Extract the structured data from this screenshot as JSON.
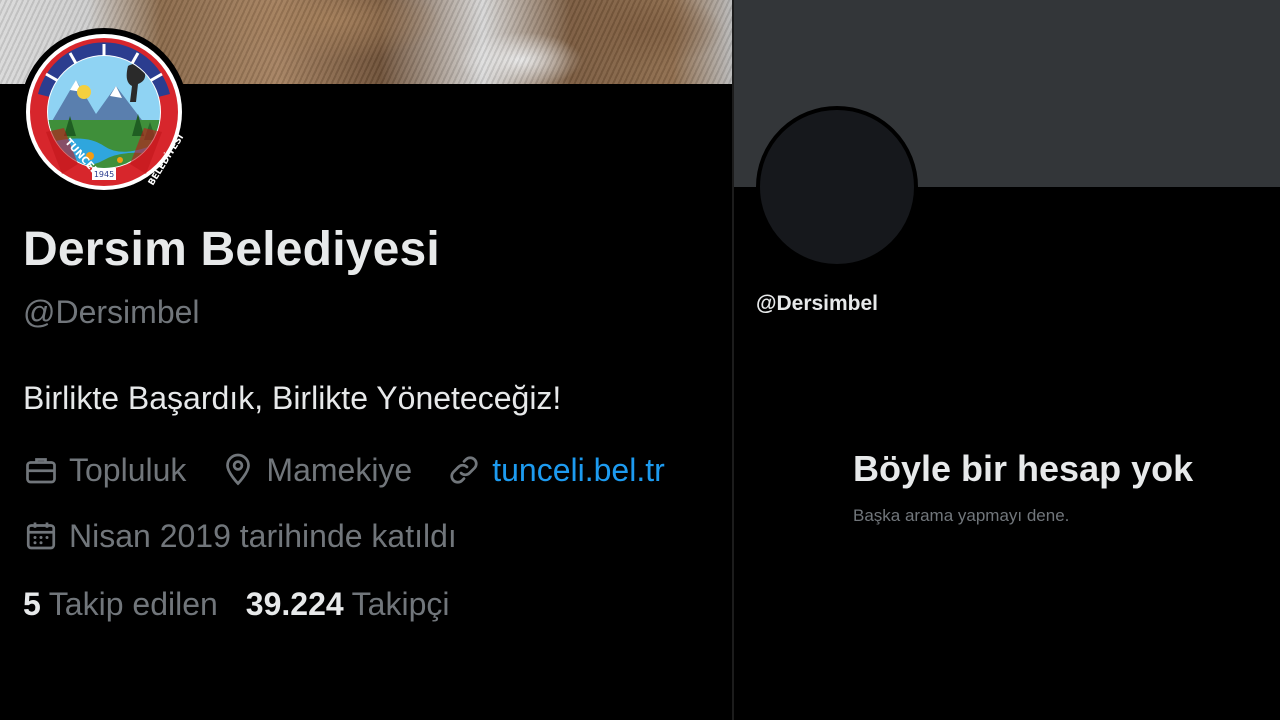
{
  "profile": {
    "display_name": "Dersim Belediyesi",
    "handle": "@Dersimbel",
    "bio": "Birlikte Başardık, Birlikte Yöneteceğiz!",
    "category": "Topluluk",
    "location": "Mamekiye",
    "website": "tunceli.bel.tr",
    "joined": "Nisan 2019 tarihinde katıldı",
    "following_count": "5",
    "following_label": "Takip edilen",
    "followers_count": "39.224",
    "followers_label": "Takipçi",
    "logo": {
      "left_text": "TUNCELİ",
      "right_text": "BELEDİYESİ",
      "year": "1945"
    }
  },
  "missing_account": {
    "handle": "@Dersimbel",
    "title": "Böyle bir hesap yok",
    "subtitle": "Başka arama yapmayı dene."
  },
  "icons": {
    "category": "briefcase-icon",
    "location": "map-pin-icon",
    "website": "link-icon",
    "joined": "calendar-icon"
  },
  "colors": {
    "background": "#000000",
    "primary_text": "#e7e9ea",
    "secondary_text": "#71767b",
    "link": "#1d9bf0",
    "empty_banner": "#333639",
    "logo_red": "#d7262c",
    "logo_blue": "#2b3d8f"
  }
}
